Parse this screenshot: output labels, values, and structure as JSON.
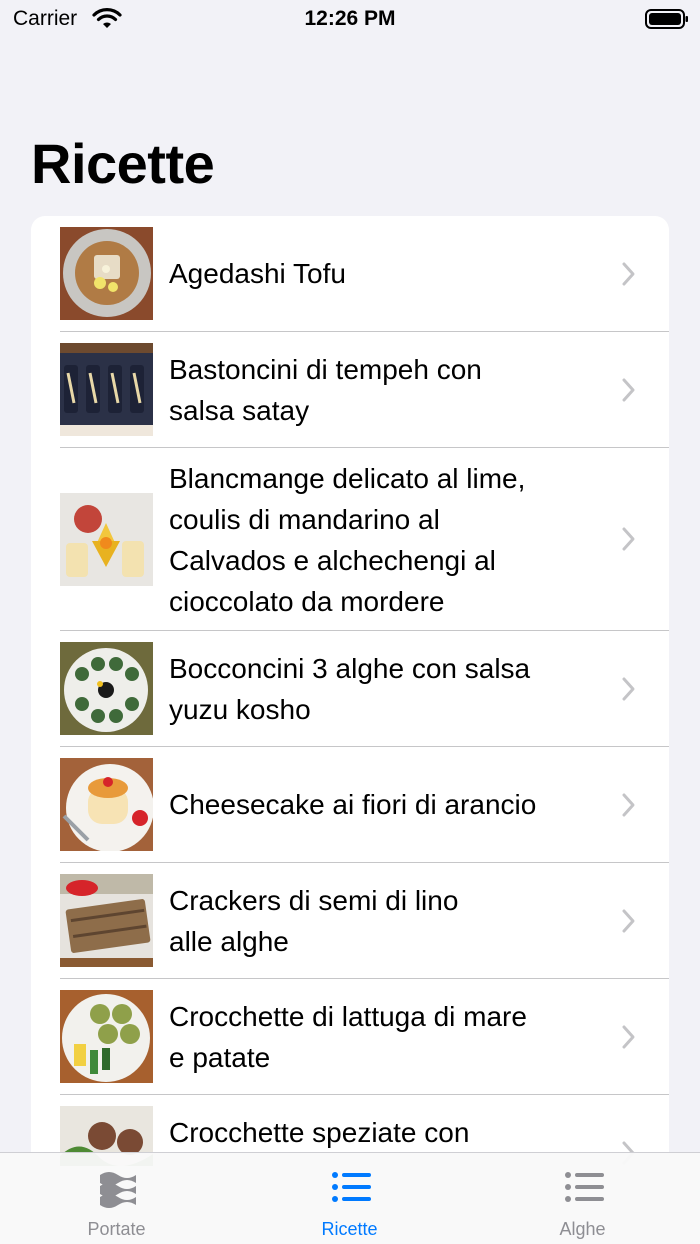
{
  "status_bar": {
    "carrier": "Carrier",
    "time": "12:26 PM"
  },
  "header": {
    "title": "Ricette"
  },
  "recipes": [
    {
      "title": "Agedashi Tofu",
      "thumb_icon": "tofu-dish-image"
    },
    {
      "title": "Bastoncini di tempeh con\nsalsa satay",
      "thumb_icon": "tempeh-sticks-image"
    },
    {
      "title": "Blancmange delicato al lime,\ncoulis di mandarino al\nCalvados e alchechengi al\ncioccolato da mordere",
      "thumb_icon": "blancmange-dessert-image"
    },
    {
      "title": "Bocconcini 3 alghe con salsa\nyuzu kosho",
      "thumb_icon": "seaweed-bites-image"
    },
    {
      "title": "Cheesecake ai fiori di arancio",
      "thumb_icon": "cheesecake-image"
    },
    {
      "title": "Crackers di semi di lino\nalle alghe",
      "thumb_icon": "crackers-image"
    },
    {
      "title": "Crocchette di lattuga di mare\ne patate",
      "thumb_icon": "croquettes-image"
    },
    {
      "title": "Crocchette speziate con",
      "thumb_icon": "spiced-croquettes-image"
    }
  ],
  "tab_bar": {
    "tabs": [
      {
        "label": "Portate",
        "icon": "waves-icon",
        "active": false
      },
      {
        "label": "Ricette",
        "icon": "list-icon",
        "active": true
      },
      {
        "label": "Alghe",
        "icon": "list-icon",
        "active": false
      }
    ]
  },
  "colors": {
    "accent": "#007aff",
    "inactive": "#8e8e93",
    "background": "#f2f2f7"
  }
}
